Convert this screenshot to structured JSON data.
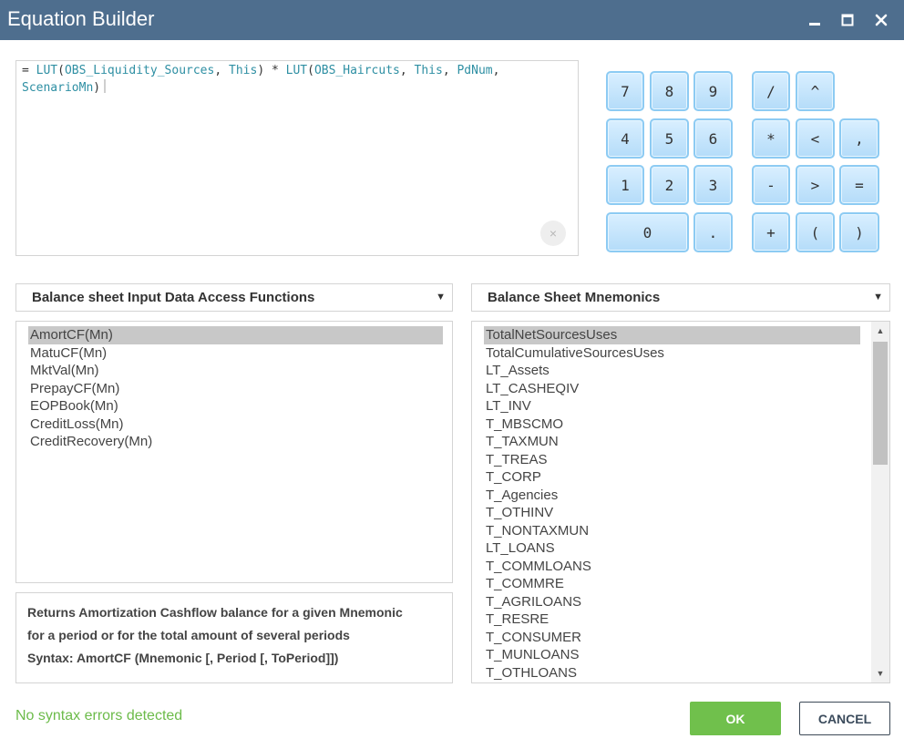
{
  "window": {
    "title": "Equation Builder",
    "controls": {
      "minimize_icon": "minimize-icon",
      "maximize_icon": "maximize-icon",
      "close_icon": "close-icon"
    }
  },
  "editor": {
    "tokens": [
      {
        "text": "= ",
        "kind": "plain"
      },
      {
        "text": "LUT",
        "kind": "fn"
      },
      {
        "text": "(",
        "kind": "plain"
      },
      {
        "text": "OBS_Liquidity_Sources",
        "kind": "fn"
      },
      {
        "text": ", ",
        "kind": "plain"
      },
      {
        "text": "This",
        "kind": "fn"
      },
      {
        "text": ") * ",
        "kind": "plain"
      },
      {
        "text": "LUT",
        "kind": "fn"
      },
      {
        "text": "(",
        "kind": "plain"
      },
      {
        "text": "OBS_Haircuts",
        "kind": "fn"
      },
      {
        "text": ", ",
        "kind": "plain"
      },
      {
        "text": "This",
        "kind": "fn"
      },
      {
        "text": ", ",
        "kind": "plain"
      },
      {
        "text": "PdNum",
        "kind": "fn"
      },
      {
        "text": ",\n",
        "kind": "plain"
      },
      {
        "text": "ScenarioMn",
        "kind": "fn"
      },
      {
        "text": ")",
        "kind": "plain"
      }
    ],
    "clear_label": "×"
  },
  "keypad": {
    "keys": [
      "7",
      "8",
      "9",
      "/",
      "^",
      "4",
      "5",
      "6",
      "*",
      "<",
      ",",
      "1",
      "2",
      "3",
      "-",
      ">",
      "=",
      "0",
      ".",
      "+",
      "(",
      ")"
    ]
  },
  "functions_dropdown": {
    "selected": "Balance sheet Input Data Access Functions",
    "caret": "▼"
  },
  "mnemonics_dropdown": {
    "selected": "Balance Sheet Mnemonics",
    "caret": "▼"
  },
  "functions_list": {
    "items": [
      "AmortCF(Mn)",
      "MatuCF(Mn)",
      "MktVal(Mn)",
      "PrepayCF(Mn)",
      "EOPBook(Mn)",
      "CreditLoss(Mn)",
      "CreditRecovery(Mn)"
    ],
    "selected_index": 0
  },
  "mnemonics_list": {
    "items": [
      "TotalNetSourcesUses",
      "TotalCumulativeSourcesUses",
      "LT_Assets",
      "LT_CASHEQIV",
      "LT_INV",
      "T_MBSCMO",
      "T_TAXMUN",
      "T_TREAS",
      "T_CORP",
      "T_Agencies",
      "T_OTHINV",
      "T_NONTAXMUN",
      "LT_LOANS",
      "T_COMMLOANS",
      "T_COMMRE",
      "T_AGRILOANS",
      "T_RESRE",
      "T_CONSUMER",
      "T_MUNLOANS",
      "T_OTHLOANS"
    ],
    "selected_index": 0,
    "scroll_up": "▲",
    "scroll_down": "▼"
  },
  "description": {
    "lines": [
      "Returns Amortization Cashflow balance for a given Mnemonic",
      "for a period or for the total amount of several periods",
      "Syntax: AmortCF (Mnemonic [, Period [, ToPeriod]])"
    ]
  },
  "status": {
    "text": "No syntax errors detected",
    "color": "#6cbb4a"
  },
  "buttons": {
    "ok_label": "OK",
    "cancel_label": "CANCEL",
    "ok_color": "#70c04c"
  }
}
